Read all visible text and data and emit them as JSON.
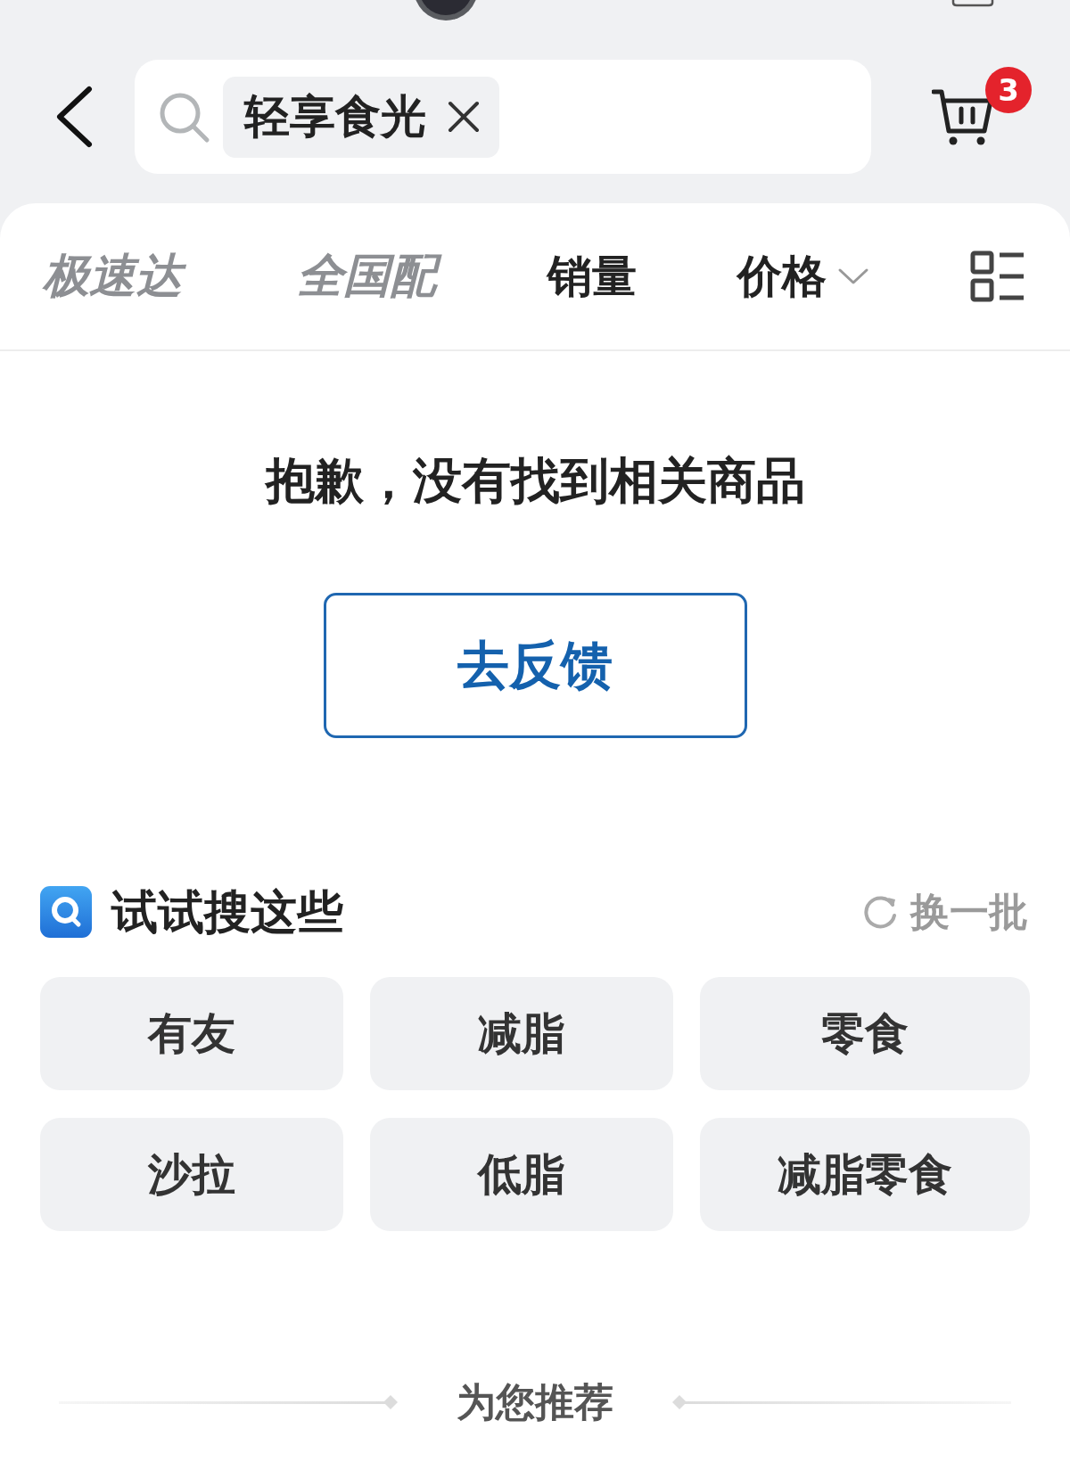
{
  "header": {
    "search_tag": "轻享食光",
    "cart_badge": "3"
  },
  "filter_tabs": [
    {
      "label": "极速达",
      "kind": "logo",
      "selected": false
    },
    {
      "label": "全国配",
      "kind": "logo",
      "selected": false
    },
    {
      "label": "销量",
      "kind": "sort",
      "selected": false
    },
    {
      "label": "价格",
      "kind": "dropdown",
      "selected": false
    }
  ],
  "empty_state": {
    "message": "抱歉，没有找到相关商品",
    "button": "去反馈"
  },
  "suggestions": {
    "title": "试试搜这些",
    "refresh": "换一批",
    "items": [
      "有友",
      "减脂",
      "零食",
      "沙拉",
      "低脂",
      "减脂零食"
    ]
  },
  "recommend": {
    "title": "为您推荐"
  }
}
